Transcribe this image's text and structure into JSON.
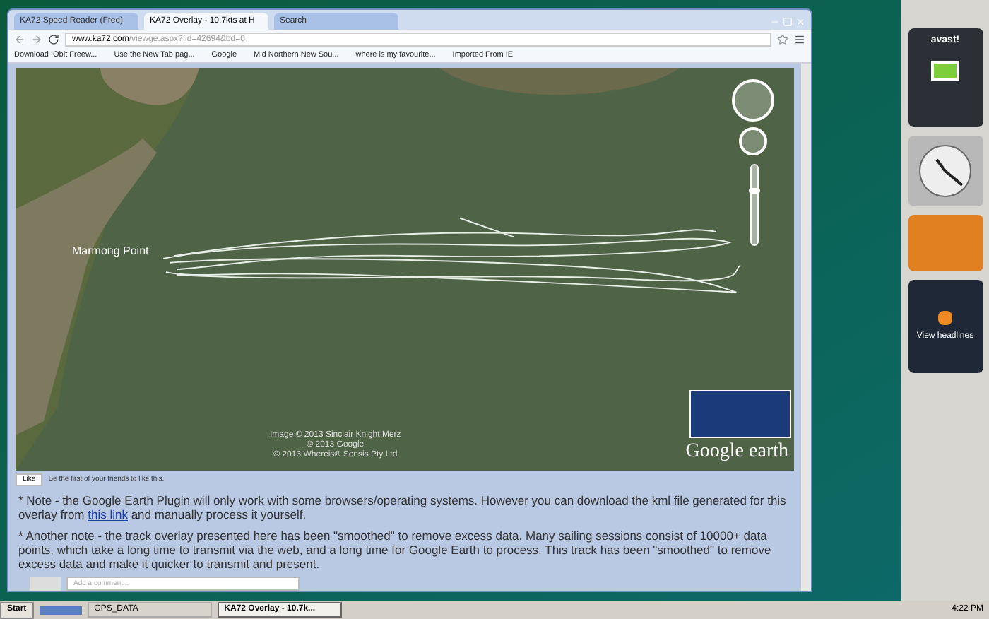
{
  "browser": {
    "tabs": [
      {
        "title": "KA72 Speed Reader (Free)",
        "selected": false
      },
      {
        "title": "KA72 Overlay - 10.7kts at H",
        "selected": true
      },
      {
        "title": "Search",
        "selected": false
      }
    ],
    "url": {
      "domain": "www.ka72.com",
      "path": "/viewge.aspx?fid=42694&bd=0"
    },
    "bookmarks": [
      "Download IObit Freew...",
      "Use the New Tab pag...",
      "Google",
      "Mid Northern New Sou...",
      "where is my favourite...",
      "Imported From IE"
    ]
  },
  "map": {
    "zoom": {
      "level": 0.7
    },
    "place_label": "Marmong Point",
    "attributions": [
      "Image © 2013 Sinclair Knight Merz",
      "© 2013 Google",
      "© 2013 Whereis® Sensis Pty Ltd"
    ],
    "logo": "Google earth"
  },
  "like": {
    "button": "Like",
    "text": "Be the first of your friends to like this."
  },
  "notes": [
    {
      "before": "* Note - the Google Earth Plugin will only work with some browsers/operating systems. However you can download the kml file generated for this overlay from ",
      "link": "this link",
      "after": " and manually process it yourself."
    },
    {
      "before": "* Another note - the track overlay presented here has been \"smoothed\" to remove excess data. Many sailing sessions consist of 10000+ data points, which take a long time to transmit via the web, and a long time for Google Earth to process. This track has been \"smoothed\" to remove excess data and make it quicker to transmit and present."
    }
  ],
  "comment": {
    "placeholder": "Add a comment..."
  },
  "sidebar": {
    "security_brand": "avast!",
    "feed_label": "View headlines"
  },
  "taskbar": {
    "start": "Start",
    "items": [
      {
        "label": "GPS_DATA",
        "selected": false
      },
      {
        "label": "KA72 Overlay - 10.7k...",
        "selected": true
      }
    ],
    "time": "4:22 PM"
  }
}
